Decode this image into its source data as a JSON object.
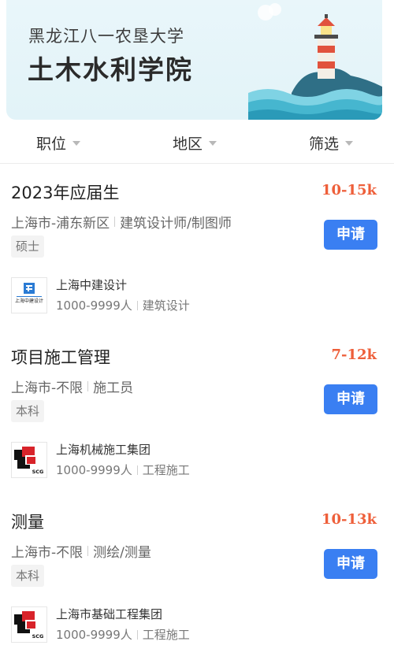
{
  "banner": {
    "subtitle": "黑龙江八一农垦大学",
    "title": "土木水利学院"
  },
  "filters": [
    {
      "label": "职位"
    },
    {
      "label": "地区"
    },
    {
      "label": "筛选"
    }
  ],
  "jobs": [
    {
      "title": "2023年应届生",
      "salary": "10-15k",
      "location": "上海市-浦东新区",
      "category": "建筑设计师/制图师",
      "tag": "硕士",
      "apply_label": "申请",
      "company": "上海中建设计",
      "size": "1000-9999人",
      "industry": "建筑设计",
      "logo_icon": "zhongjian-logo-icon",
      "logo_text": "上海中建设计"
    },
    {
      "title": "项目施工管理",
      "salary": "7-12k",
      "location": "上海市-不限",
      "category": "施工员",
      "tag": "本科",
      "apply_label": "申请",
      "company": "上海机械施工集团",
      "size": "1000-9999人",
      "industry": "工程施工",
      "logo_icon": "scg-logo-icon",
      "logo_text": "SCG"
    },
    {
      "title": "测量",
      "salary": "10-13k",
      "location": "上海市-不限",
      "category": "测绘/测量",
      "tag": "本科",
      "apply_label": "申请",
      "company": "上海市基础工程集团",
      "size": "1000-9999人",
      "industry": "工程施工",
      "logo_icon": "scg-logo-icon",
      "logo_text": "SCG"
    }
  ],
  "colors": {
    "salary": "#ee5f3a",
    "apply_button": "#3a7ff2"
  }
}
